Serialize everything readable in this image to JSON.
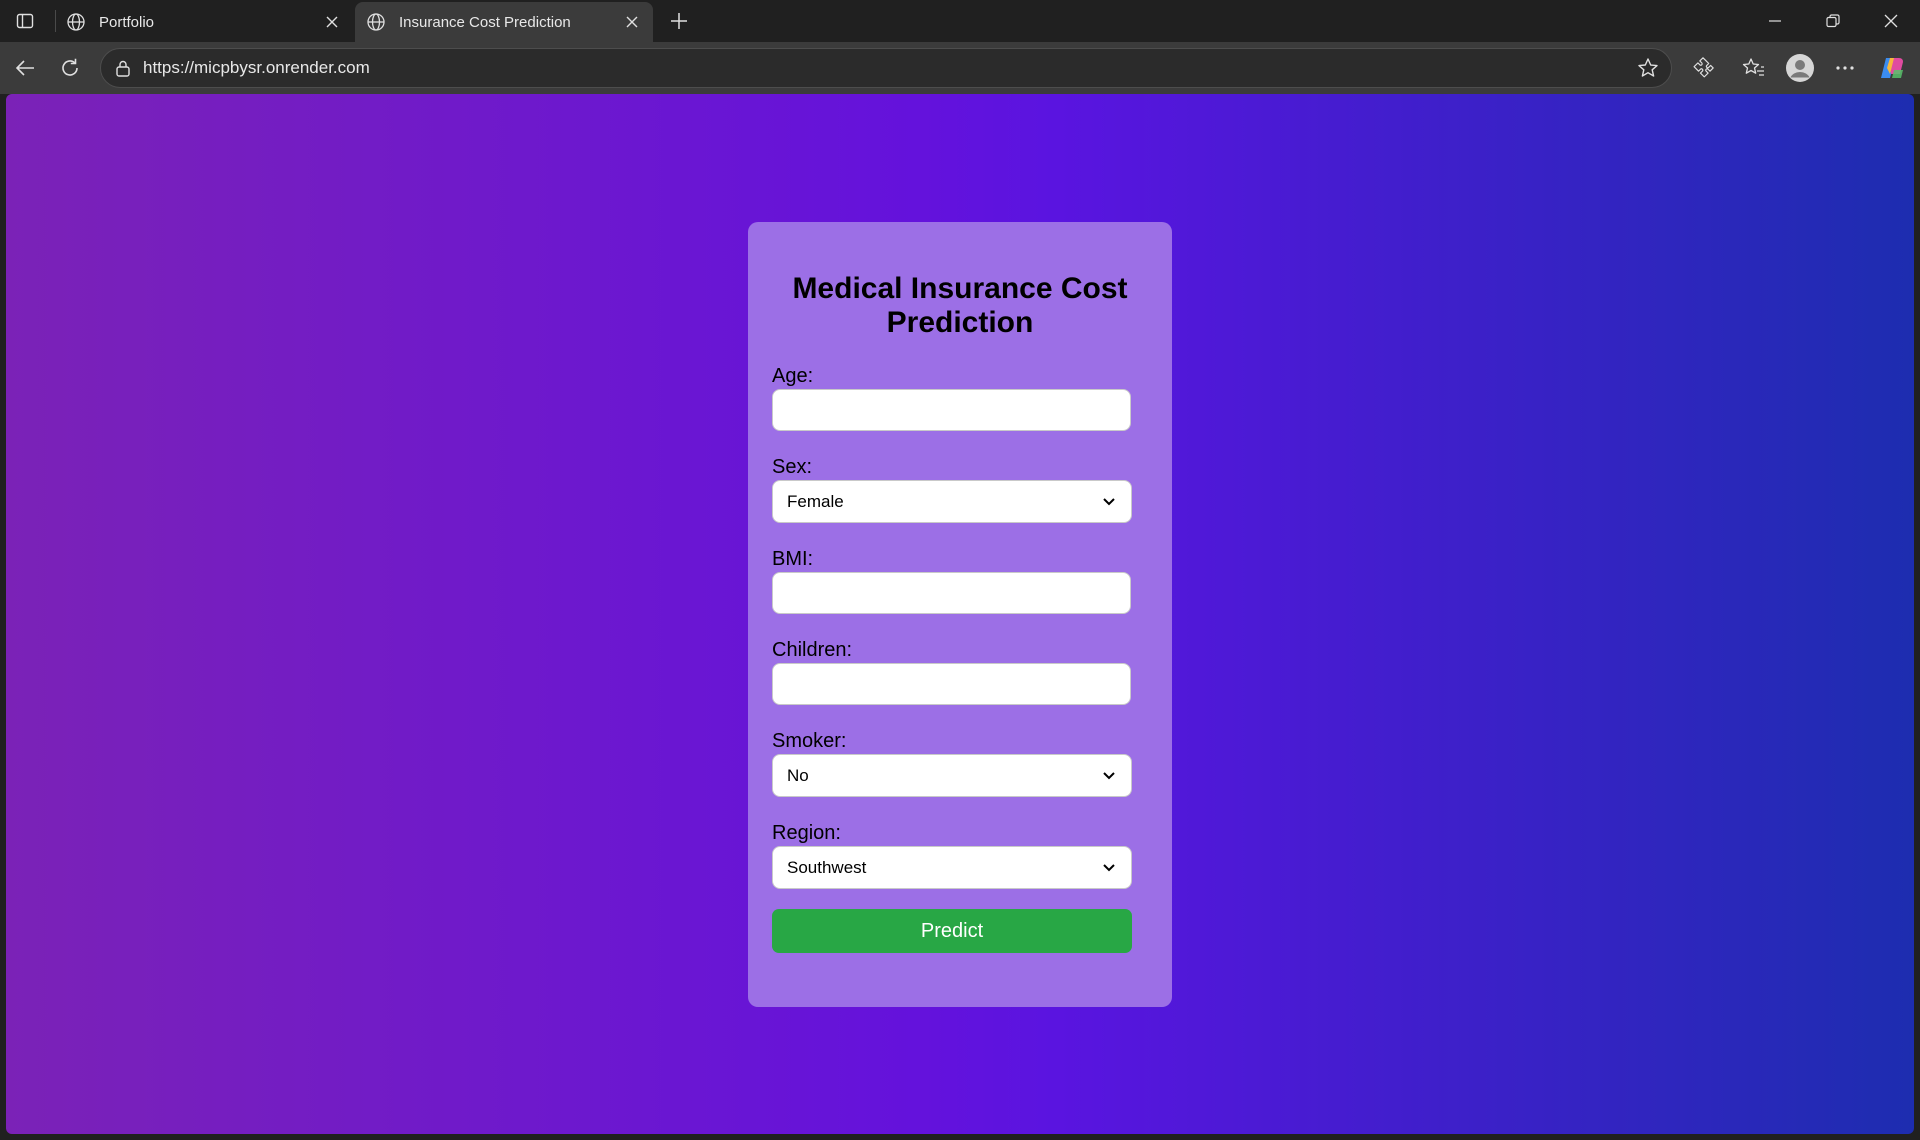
{
  "browser": {
    "tabs": [
      {
        "label": "Portfolio",
        "active": false
      },
      {
        "label": "Insurance Cost Prediction",
        "active": true
      }
    ],
    "url": "https://micpbysr.onrender.com"
  },
  "page": {
    "title": "Medical Insurance Cost Prediction",
    "fields": {
      "age": {
        "label": "Age:",
        "value": ""
      },
      "sex": {
        "label": "Sex:",
        "value": "Female"
      },
      "bmi": {
        "label": "BMI:",
        "value": ""
      },
      "children": {
        "label": "Children:",
        "value": ""
      },
      "smoker": {
        "label": "Smoker:",
        "value": "No"
      },
      "region": {
        "label": "Region:",
        "value": "Southwest"
      }
    },
    "submit_label": "Predict"
  },
  "colors": {
    "gradient_start": "#7b22b7",
    "gradient_mid": "#6412dc",
    "gradient_end": "#1d2db0",
    "card": "#9c6fe6",
    "predict_button": "#28a745"
  },
  "icons": [
    "sidebar-toggle-icon",
    "globe-icon",
    "close-icon",
    "plus-icon",
    "minimize-icon",
    "restore-icon",
    "back-arrow-icon",
    "refresh-icon",
    "lock-icon",
    "star-icon",
    "extensions-icon",
    "favorites-icon",
    "profile-icon",
    "more-icon",
    "copilot-icon",
    "chevron-down-icon"
  ]
}
